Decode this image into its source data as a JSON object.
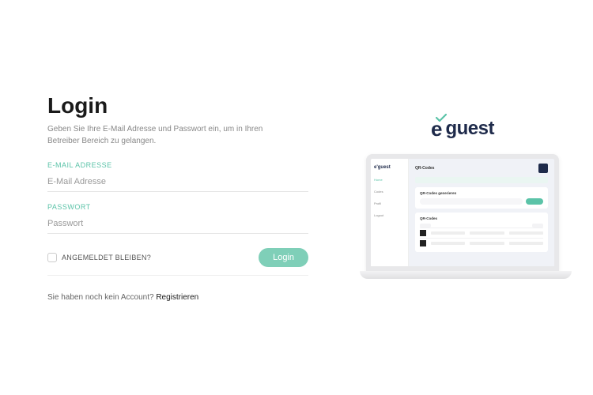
{
  "login": {
    "title": "Login",
    "subtitle": "Geben Sie Ihre E-Mail Adresse und Passwort ein, um in Ihren Betreiber Bereich zu gelangen.",
    "email_label": "E-MAIL ADRESSE",
    "email_placeholder": "E-Mail Adresse",
    "password_label": "PASSWORT",
    "password_placeholder": "Passwort",
    "remember_label": "ANGEMELDET BLEIBEN?",
    "login_button": "Login",
    "no_account_text": "Sie haben noch kein Account? ",
    "register_link": "Registrieren"
  },
  "brand": {
    "e": "e",
    "guest": "guest"
  },
  "preview": {
    "logo": "e'guest",
    "nav": [
      "Home",
      "Codes",
      "Profil",
      "Logout"
    ],
    "section1_title": "QR-Codes",
    "section_gen_title": "QR-Codes generieren",
    "section_list_title": "QR-Codes"
  }
}
